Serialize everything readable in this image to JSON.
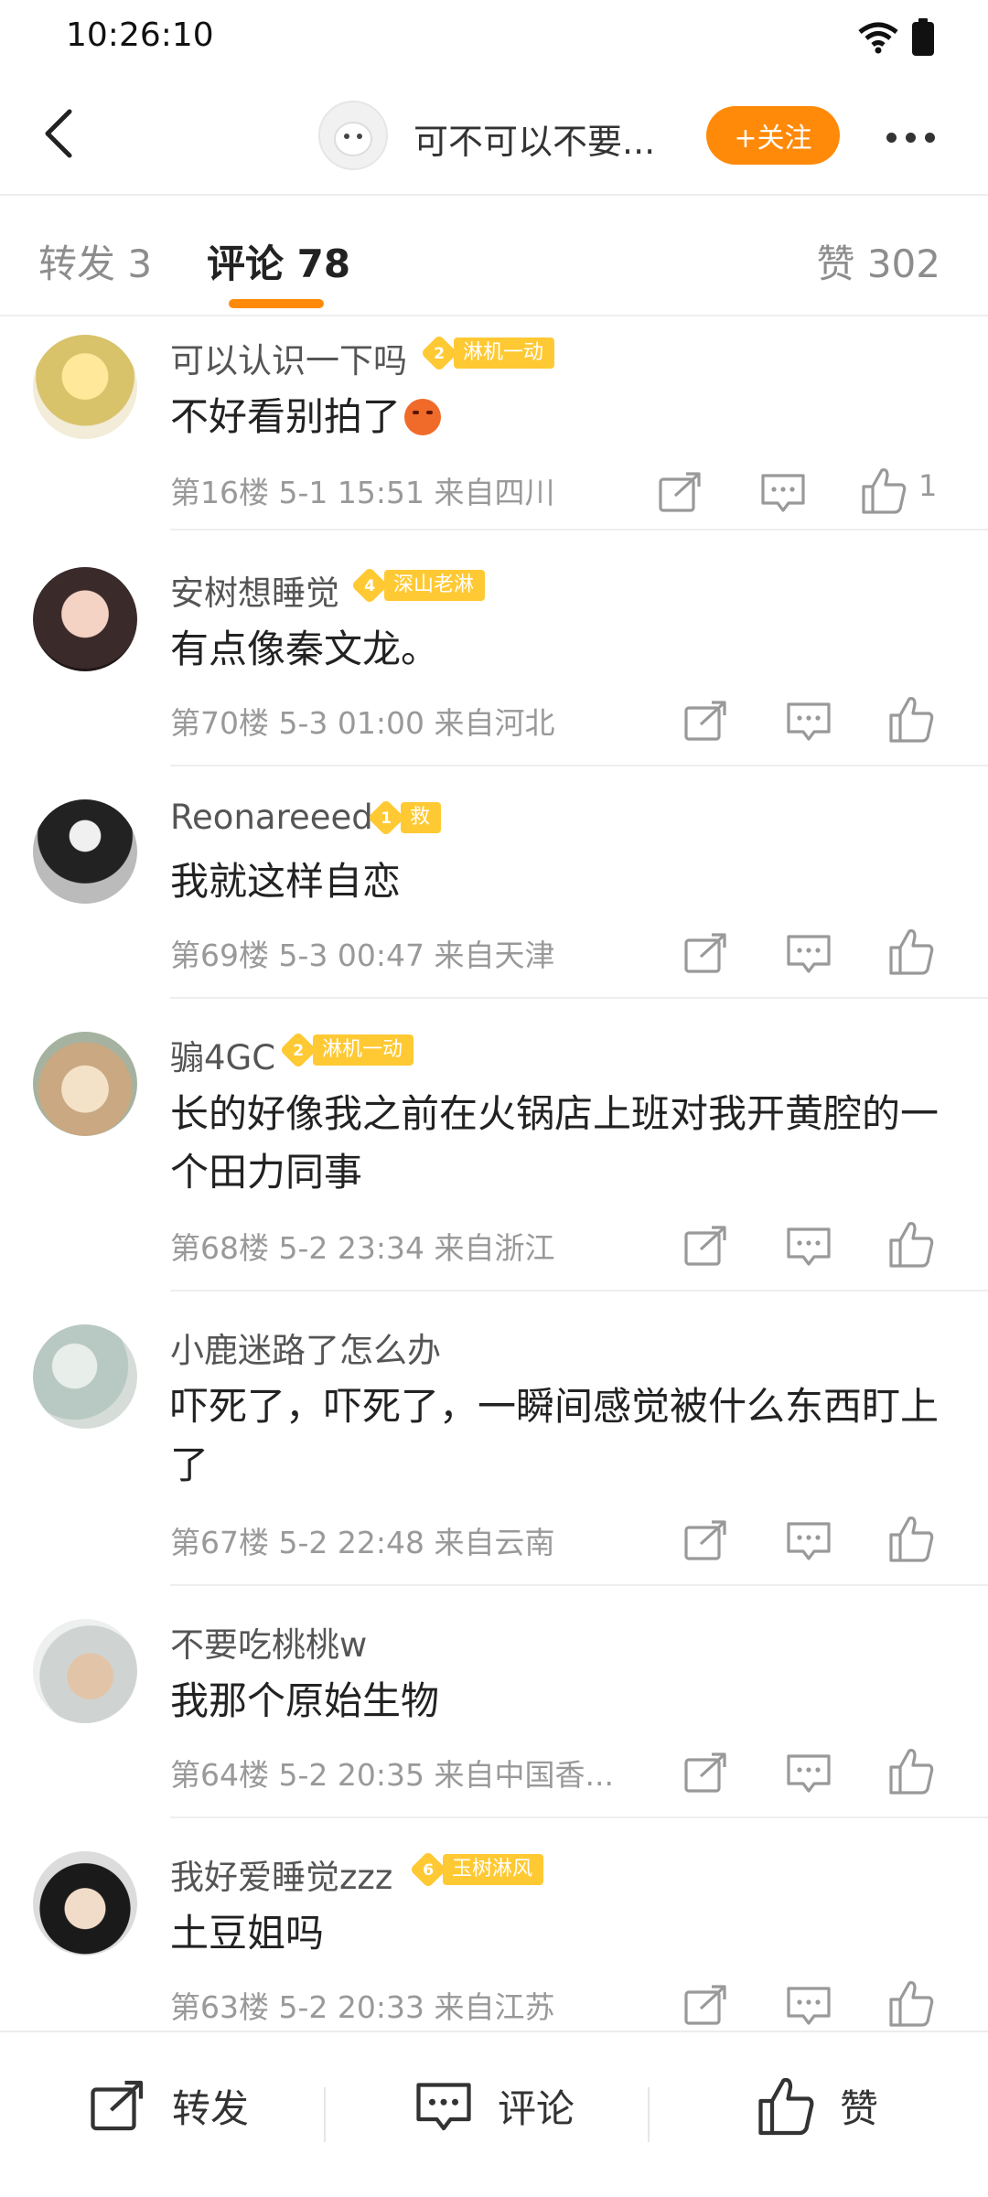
{
  "status": {
    "time": "10:26:10"
  },
  "header": {
    "title": "可不可以不要...",
    "follow_label": "+关注"
  },
  "tabs": {
    "repost": "转发 3",
    "comments": "评论 78",
    "likes": "赞 302"
  },
  "comments": [
    {
      "name": "可以认识一下吗",
      "badge_level": "2",
      "badge_text": "淋机一动",
      "text": "不好看别拍了",
      "has_emoji": true,
      "meta": "第16楼 5-1 15:51 来自四川",
      "like_count": "1"
    },
    {
      "name": "安树想睡觉",
      "badge_level": "4",
      "badge_text": "深山老淋",
      "text": "有点像秦文龙。",
      "meta": "第70楼 5-3 01:00 来自河北"
    },
    {
      "name": "Reonareeed",
      "badge_level": "1",
      "badge_text": "救",
      "text": "我就这样自恋",
      "meta": "第69楼 5-3 00:47 来自天津"
    },
    {
      "name": "骟4GC",
      "badge_level": "2",
      "badge_text": "淋机一动",
      "text": "长的好像我之前在火锅店上班对我开黄腔的一个田力同事",
      "meta": "第68楼 5-2 23:34 来自浙江"
    },
    {
      "name": "小鹿迷路了怎么办",
      "text": "吓死了，吓死了，一瞬间感觉被什么东西盯上了",
      "meta": "第67楼 5-2 22:48 来自云南"
    },
    {
      "name": "不要吃桃桃w",
      "text": "我那个原始生物",
      "meta": "第64楼 5-2 20:35 来自中国香..."
    },
    {
      "name": "我好爱睡觉zzz",
      "badge_level": "6",
      "badge_text": "玉树淋风",
      "text": "土豆姐吗",
      "meta": "第63楼 5-2 20:33 来自江苏"
    }
  ],
  "bottom": {
    "repost": "转发",
    "comment": "评论",
    "like": "赞"
  },
  "colors": {
    "accent": "#ff8a0a",
    "badge": "#ffc933",
    "meta_text": "#999999"
  },
  "icons": [
    "wifi-icon",
    "battery-icon",
    "back-arrow-icon",
    "more-icon",
    "repost-icon",
    "comment-icon",
    "like-icon"
  ]
}
